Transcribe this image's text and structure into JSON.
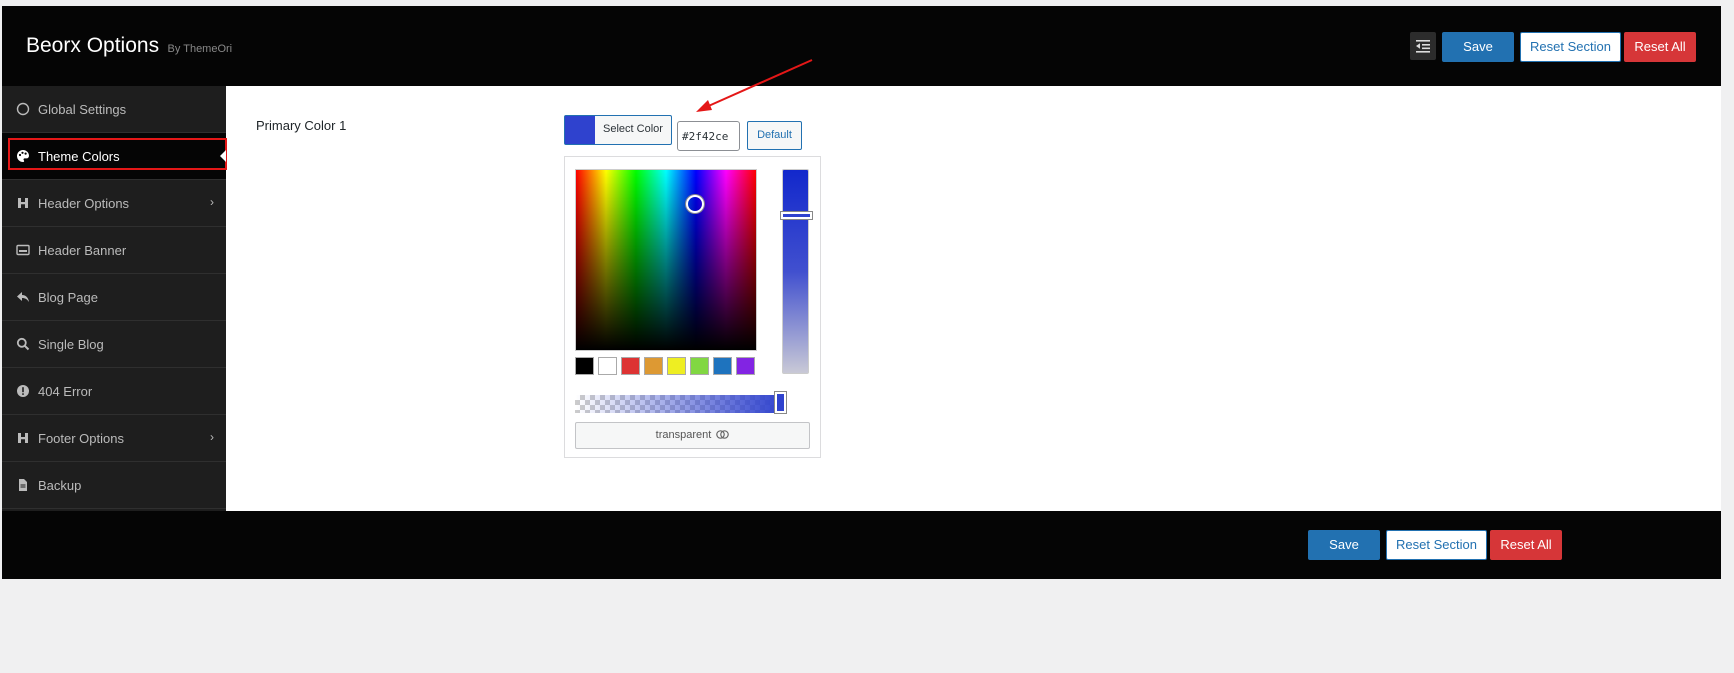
{
  "app": {
    "title": "Beorx Options",
    "byline": "By ThemeOri"
  },
  "header": {
    "expand_icon": "expand-icon",
    "save_label": "Save",
    "reset_section_label": "Reset Section",
    "reset_all_label": "Reset All"
  },
  "sidebar": {
    "active_index": 1,
    "items": [
      {
        "label": "Global Settings",
        "icon": "circle-icon",
        "has_children": false
      },
      {
        "label": "Theme Colors",
        "icon": "palette-icon",
        "has_children": false
      },
      {
        "label": "Header Options",
        "icon": "heading-icon",
        "has_children": true
      },
      {
        "label": "Header Banner",
        "icon": "banner-icon",
        "has_children": false
      },
      {
        "label": "Blog Page",
        "icon": "reply-icon",
        "has_children": false
      },
      {
        "label": "Single Blog",
        "icon": "search-icon",
        "has_children": false
      },
      {
        "label": "404 Error",
        "icon": "exclamation-circle-icon",
        "has_children": false
      },
      {
        "label": "Footer Options",
        "icon": "heading-icon",
        "has_children": true
      },
      {
        "label": "Backup",
        "icon": "file-icon",
        "has_children": false
      }
    ]
  },
  "field": {
    "label": "Primary Color 1",
    "select_color_label": "Select Color",
    "hex_value": "#2f42ce",
    "default_label": "Default",
    "transparent_label": "transparent",
    "current_color": "#2f42ce"
  },
  "picker": {
    "palette": [
      "#000000",
      "#ffffff",
      "#dd3333",
      "#dd9933",
      "#eeee22",
      "#81d742",
      "#1e73be",
      "#8224e3"
    ]
  },
  "footer": {
    "save_label": "Save",
    "reset_section_label": "Reset Section",
    "reset_all_label": "Reset All"
  },
  "colors": {
    "accent": "#2271b1",
    "danger": "#d63638",
    "highlight": "#e41717",
    "bar_bg": "#050505",
    "sidebar_bg": "#1e1e1e"
  }
}
